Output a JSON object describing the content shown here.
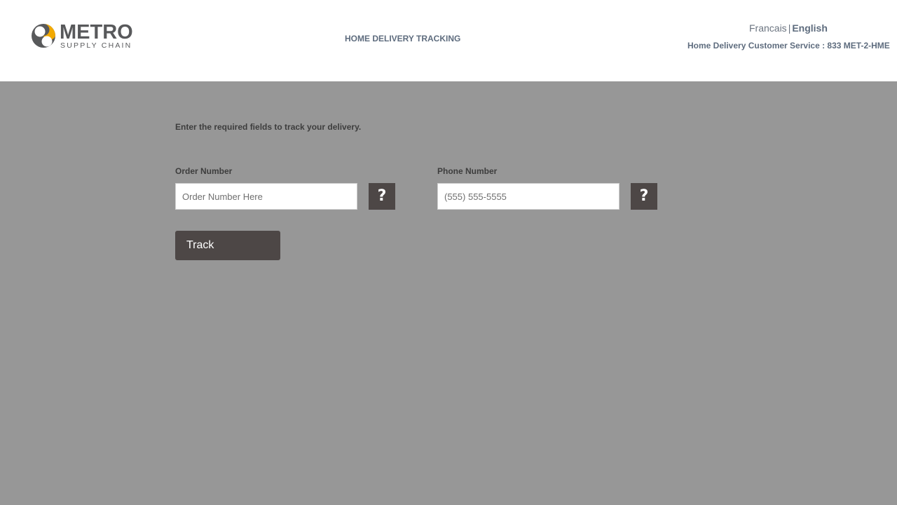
{
  "header": {
    "logo": {
      "main": "METRO",
      "sub": "SUPPLY CHAIN",
      "icon": "metro-swirl-logo-icon",
      "colors": {
        "gold": "#f2a900",
        "gray": "#58595b"
      }
    },
    "title": "HOME DELIVERY TRACKING",
    "language": {
      "french": "Francais",
      "separator": "|",
      "english": "English",
      "active": "English"
    },
    "customer_service": "Home Delivery Customer Service : 833 MET-2-HME"
  },
  "form": {
    "instructions": "Enter the required fields to track your delivery.",
    "order_number": {
      "label": "Order Number",
      "value": "",
      "placeholder": "Order Number Here",
      "help_label": "?",
      "help_icon": "question-mark-icon"
    },
    "phone_number": {
      "label": "Phone Number",
      "value": "",
      "placeholder": "(555) 555-5555",
      "help_label": "?",
      "help_icon": "question-mark-icon"
    },
    "track_button": "Track"
  },
  "colors": {
    "page_background": "#979797",
    "header_background": "#ffffff",
    "button": "#4d4746",
    "header_text": "#5e6c7e",
    "body_text": "#3d3d3d"
  }
}
